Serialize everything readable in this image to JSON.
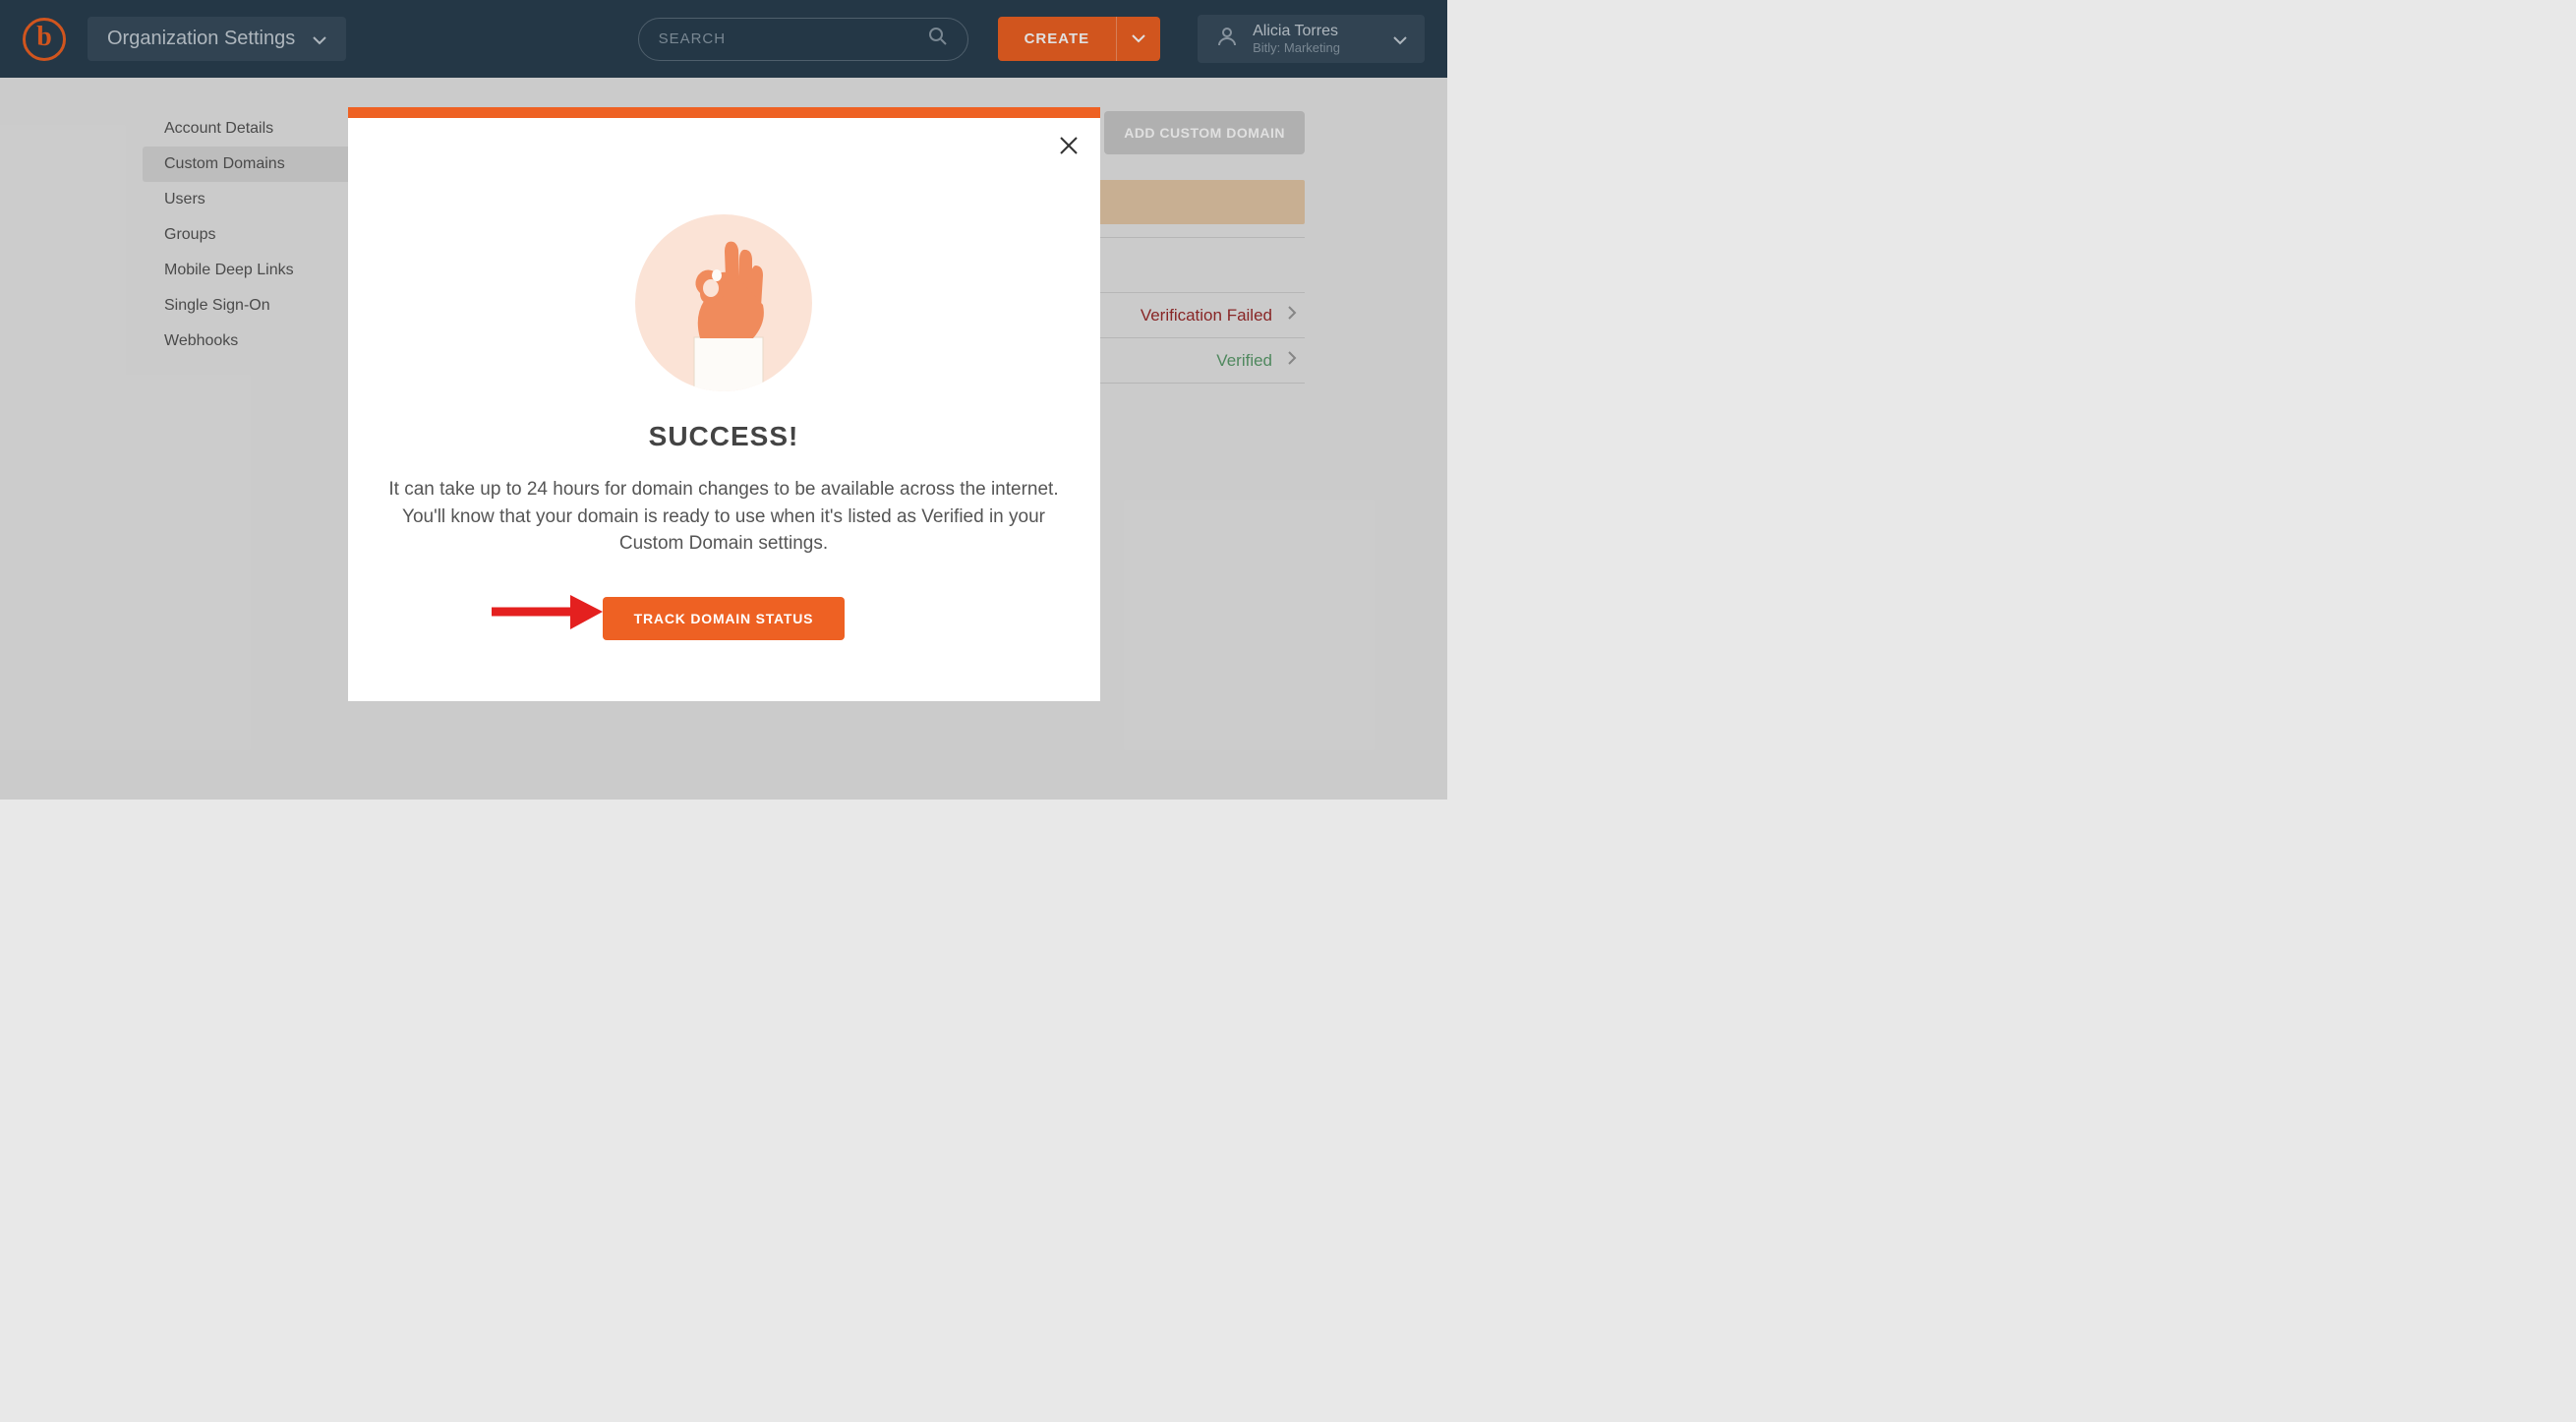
{
  "header": {
    "org_dropdown_label": "Organization Settings",
    "search_placeholder": "SEARCH",
    "create_label": "CREATE",
    "user_name": "Alicia Torres",
    "user_org": "Bitly: Marketing"
  },
  "sidebar": {
    "items": [
      {
        "label": "Account Details"
      },
      {
        "label": "Custom Domains"
      },
      {
        "label": "Users"
      },
      {
        "label": "Groups"
      },
      {
        "label": "Mobile Deep Links"
      },
      {
        "label": "Single Sign-On"
      },
      {
        "label": "Webhooks"
      }
    ],
    "active_index": 1
  },
  "main": {
    "add_button_label": "ADD CUSTOM DOMAIN",
    "domains": [
      {
        "status_label": "Verification Failed",
        "status": "failed"
      },
      {
        "status_label": "Verified",
        "status": "verified"
      }
    ]
  },
  "modal": {
    "title": "SUCCESS!",
    "body": "It can take up to 24 hours for domain changes to be available across the internet. You'll know that your domain is ready to use when it's listed as Verified in your Custom Domain settings.",
    "cta_label": "TRACK DOMAIN STATUS"
  },
  "colors": {
    "accent": "#ee6123",
    "navy": "#2a3f50"
  }
}
